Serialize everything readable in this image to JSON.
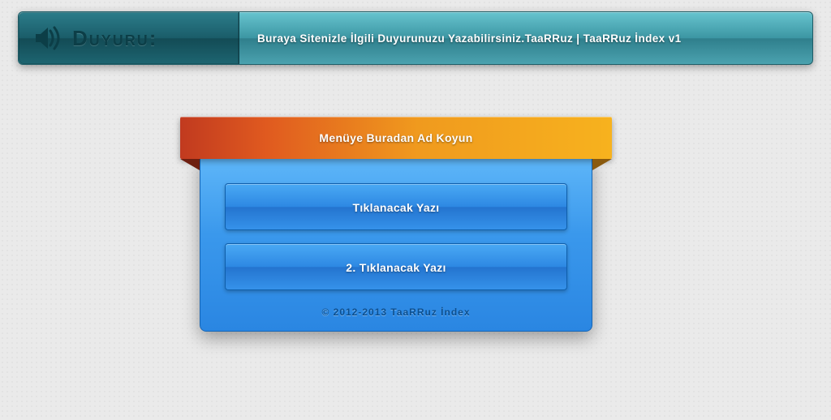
{
  "announce": {
    "title": "Duyuru:",
    "text": "Buraya Sitenizle İlgili Duyurunuzu Yazabilirsiniz.TaaRRuz | TaaRRuz İndex v1"
  },
  "menu": {
    "title": "Menüye Buradan Ad Koyun",
    "items": [
      {
        "label": "Tıklanacak Yazı"
      },
      {
        "label": "2. Tıklanacak Yazı"
      }
    ]
  },
  "footer": "© 2012-2013 TaaRRuz İndex"
}
